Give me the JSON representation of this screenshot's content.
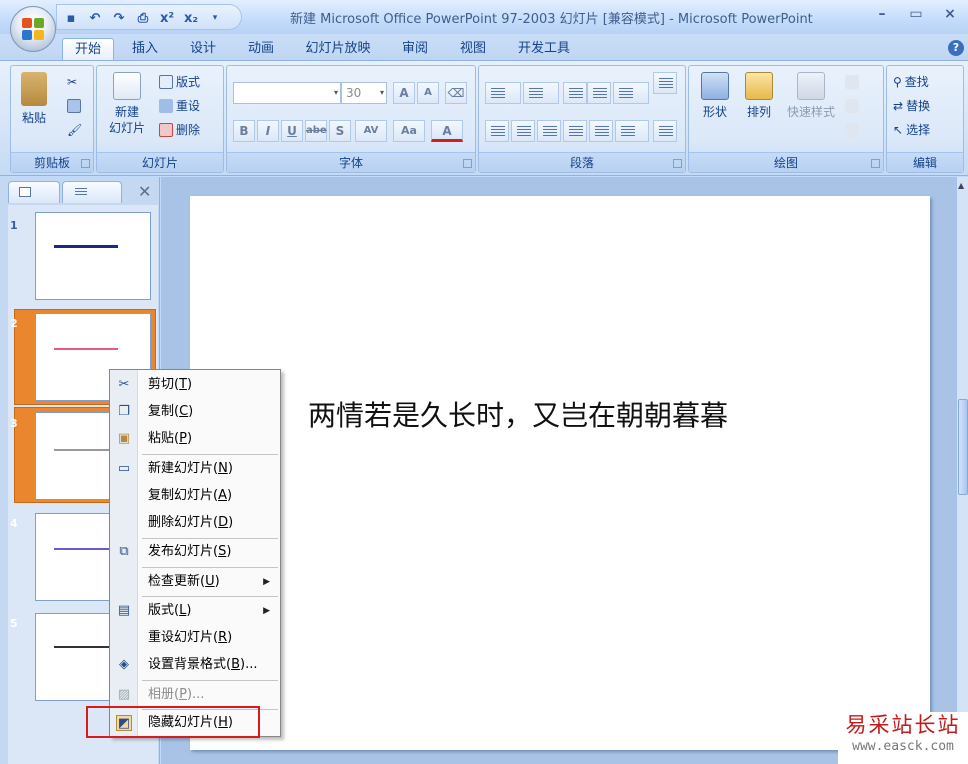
{
  "window": {
    "title": "新建 Microsoft Office PowerPoint 97-2003 幻灯片 [兼容模式] - Microsoft PowerPoint",
    "minimize": "–",
    "maximize": "▭",
    "close": "×"
  },
  "tabs": [
    "开始",
    "插入",
    "设计",
    "动画",
    "幻灯片放映",
    "审阅",
    "视图",
    "开发工具"
  ],
  "help": "?",
  "ribbon": {
    "clipboard": {
      "paste": "粘贴",
      "label": "剪贴板"
    },
    "slides": {
      "new_slide": "新建",
      "new_slide_2": "幻灯片",
      "layout": "版式",
      "reset": "重设",
      "delete": "删除",
      "label": "幻灯片"
    },
    "font": {
      "font_name": "",
      "font_size": "30",
      "label": "字体",
      "bold": "B",
      "italic": "I",
      "underline": "U",
      "strike": "abe",
      "shadow": "S",
      "spacing": "AV",
      "case": "Aa",
      "color": "A"
    },
    "paragraph": {
      "label": "段落"
    },
    "drawing": {
      "shapes": "形状",
      "arrange": "排列",
      "quick_styles": "快速样式",
      "label": "绘图"
    },
    "editing": {
      "find": "查找",
      "replace": "替换",
      "select": "选择",
      "label": "编辑"
    }
  },
  "thumbnails": [
    {
      "num": "1"
    },
    {
      "num": "2"
    },
    {
      "num": "3"
    },
    {
      "num": "4"
    },
    {
      "num": "5"
    }
  ],
  "slide": {
    "text": "两情若是久长时，又岂在朝朝暮暮"
  },
  "context_menu": {
    "items": [
      {
        "label": "剪切",
        "key": "T"
      },
      {
        "label": "复制",
        "key": "C"
      },
      {
        "label": "粘贴",
        "key": "P"
      },
      {
        "label": "新建幻灯片",
        "key": "N"
      },
      {
        "label": "复制幻灯片",
        "key": "A"
      },
      {
        "label": "删除幻灯片",
        "key": "D"
      },
      {
        "label": "发布幻灯片",
        "key": "S"
      },
      {
        "label": "检查更新",
        "key": "U"
      },
      {
        "label": "版式",
        "key": "L"
      },
      {
        "label": "重设幻灯片",
        "key": "R"
      },
      {
        "label": "设置背景格式",
        "key": "B",
        "suffix": "..."
      },
      {
        "label": "相册",
        "key": "P",
        "suffix": "..."
      },
      {
        "label": "隐藏幻灯片",
        "key": "H"
      }
    ]
  },
  "watermark": {
    "title": "易采站长站",
    "url": "www.easck.com"
  },
  "colors": {
    "accent": "#15428b",
    "highlight": "#d61c1c",
    "selected_slide": "#e9862e"
  }
}
